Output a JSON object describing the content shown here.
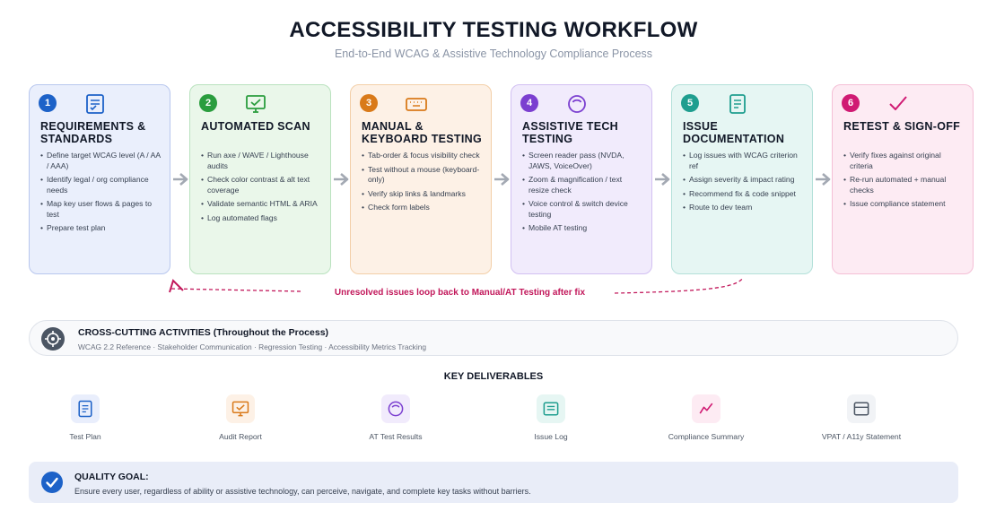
{
  "header": {
    "title": "ACCESSIBILITY TESTING WORKFLOW",
    "subtitle": "End-to-End WCAG & Assistive Technology Compliance Process"
  },
  "steps": [
    {
      "number": "1",
      "title": "REQUIREMENTS & STANDARDS",
      "icon": "checklist-icon",
      "color": "#1d62c8",
      "bg": "#eaeffc",
      "border": "#b8c7ee",
      "items": [
        "Define target WCAG level (A / AA / AAA)",
        "Identify legal / org compliance needs",
        "Map key user flows & pages to test",
        "Prepare test plan"
      ]
    },
    {
      "number": "2",
      "title": "AUTOMATED SCAN",
      "icon": "monitor-check-icon",
      "color": "#2a9d3e",
      "bg": "#eaf7ea",
      "border": "#b9e2be",
      "items": [
        "Run axe / WAVE / Lighthouse audits",
        "Check color contrast & alt text coverage",
        "Validate semantic HTML & ARIA",
        "Log automated flags"
      ]
    },
    {
      "number": "3",
      "title": "MANUAL & KEYBOARD TESTING",
      "icon": "keyboard-icon",
      "color": "#d97a1a",
      "bg": "#fdf1e6",
      "border": "#f3cfa8",
      "items": [
        "Tab-order & focus visibility check",
        "Test without a mouse (keyboard-only)",
        "Verify skip links & landmarks",
        "Check form labels"
      ]
    },
    {
      "number": "4",
      "title": "ASSISTIVE TECH TESTING",
      "icon": "accessibility-icon",
      "color": "#7b3fd0",
      "bg": "#f1ebfc",
      "border": "#d2c0f2",
      "items": [
        "Screen reader pass (NVDA, JAWS, VoiceOver)",
        "Zoom & magnification / text resize check",
        "Voice control & switch device testing",
        "Mobile AT testing"
      ]
    },
    {
      "number": "5",
      "title": "ISSUE DOCUMENTATION",
      "icon": "document-icon",
      "color": "#1f9e8f",
      "bg": "#e6f6f3",
      "border": "#b3e0d9",
      "items": [
        "Log issues with WCAG criterion ref",
        "Assign severity & impact rating",
        "Recommend fix & code snippet",
        "Route to dev team"
      ]
    },
    {
      "number": "6",
      "title": "RETEST & SIGN-OFF",
      "icon": "checkmark-icon",
      "color": "#d01a73",
      "bg": "#fdebf3",
      "border": "#f4bfd6",
      "items": [
        "Verify fixes against original criteria",
        "Re-run automated + manual checks",
        "Issue compliance statement"
      ]
    }
  ],
  "loop": {
    "label": "Unresolved issues loop back to Manual/AT Testing after fix",
    "color": "#c2185b"
  },
  "cross_cutting": {
    "icon": "target-icon",
    "title": "CROSS-CUTTING ACTIVITIES (Throughout the Process)",
    "items": "WCAG 2.2 Reference · Stakeholder Communication · Regression Testing · Accessibility Metrics Tracking"
  },
  "deliverables": {
    "title": "KEY DELIVERABLES",
    "items": [
      {
        "label": "Test Plan",
        "icon": "document-icon",
        "color": "#1d62c8",
        "bg": "#e9eefc"
      },
      {
        "label": "Audit Report",
        "icon": "monitor-check-icon",
        "color": "#d97a1a",
        "bg": "#fdf1e6"
      },
      {
        "label": "AT Test Results",
        "icon": "accessibility-icon",
        "color": "#7b3fd0",
        "bg": "#f1ebfc"
      },
      {
        "label": "Issue Log",
        "icon": "list-icon",
        "color": "#1f9e8f",
        "bg": "#e6f6f3"
      },
      {
        "label": "Compliance Summary",
        "icon": "trend-icon",
        "color": "#d01a73",
        "bg": "#fdebf3"
      },
      {
        "label": "VPAT / A11y Statement",
        "icon": "window-icon",
        "color": "#4b5563",
        "bg": "#f1f3f6"
      }
    ]
  },
  "quality_goal": {
    "icon": "check-circle-icon",
    "title": "QUALITY GOAL:",
    "text": "Ensure every user, regardless of ability or assistive technology, can perceive, navigate, and complete key tasks without barriers."
  }
}
